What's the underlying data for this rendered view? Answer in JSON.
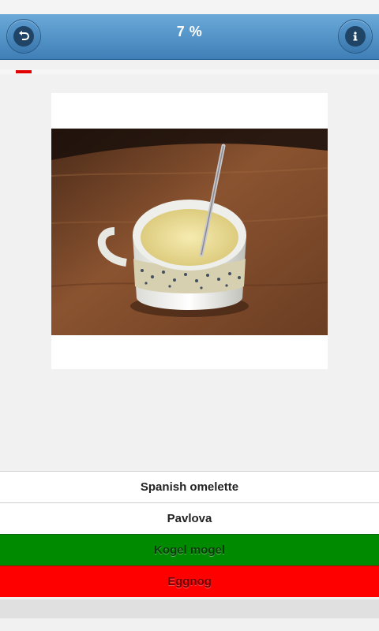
{
  "header": {
    "progress_text": "7 %",
    "back_icon": "undo-arrow-icon",
    "info_icon": "info-icon"
  },
  "progress": {
    "fraction": 0.07,
    "color": "#e00000"
  },
  "quiz_image": {
    "subject": "cup-of-eggnog-photo"
  },
  "answers": [
    {
      "label": "Spanish omelette",
      "state": "neutral"
    },
    {
      "label": "Pavlova",
      "state": "neutral"
    },
    {
      "label": "Kogel mogel",
      "state": "correct",
      "color": "#008a00"
    },
    {
      "label": "Eggnog",
      "state": "wrong",
      "color": "#ff0000"
    }
  ],
  "colors": {
    "header": "#4f8fc7",
    "background": "#f1f1f1"
  }
}
